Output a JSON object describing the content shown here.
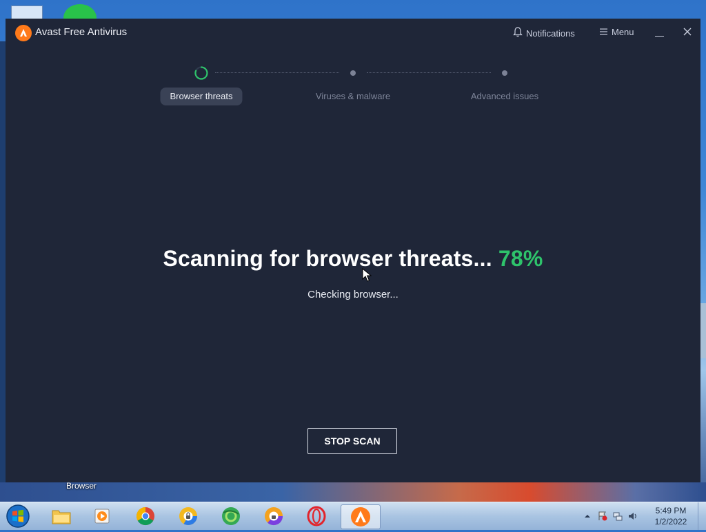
{
  "desktop": {
    "icon_label": "Browser"
  },
  "app": {
    "title": "Avast Free Antivirus",
    "notifications_label": "Notifications",
    "menu_label": "Menu"
  },
  "steps": [
    {
      "label": "Browser threats",
      "state": "active"
    },
    {
      "label": "Viruses & malware",
      "state": "pending"
    },
    {
      "label": "Advanced issues",
      "state": "pending"
    }
  ],
  "scan": {
    "headline": "Scanning for browser threats...",
    "percent": "78%",
    "status": "Checking browser...",
    "stop_label": "STOP SCAN"
  },
  "colors": {
    "window_bg": "#1f2638",
    "accent_green": "#2ec36b",
    "brand_orange": "#ff7a1a"
  },
  "taskbar": {
    "apps": [
      "folder-icon",
      "media-player-icon",
      "chrome-icon",
      "browser-lock-icon",
      "green-browser-icon",
      "avast-browser-icon",
      "opera-icon",
      "avast-icon"
    ],
    "clock_time": "5:49 PM",
    "clock_date": "1/2/2022"
  }
}
